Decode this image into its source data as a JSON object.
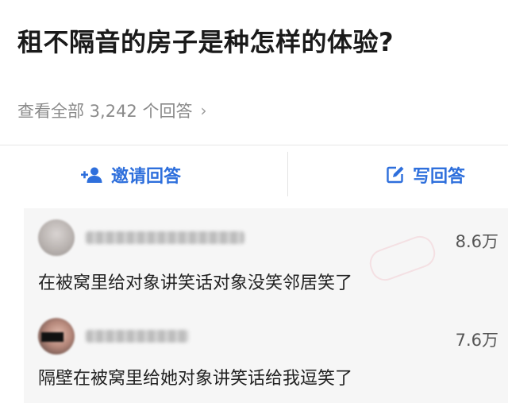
{
  "question": {
    "title": "租不隔音的房子是种怎样的体验?"
  },
  "answers_summary": {
    "text": "查看全部 3,242 个回答",
    "chevron": "›"
  },
  "actions": {
    "invite_label": "邀请回答",
    "invite_icon": "add-user-icon",
    "write_label": "写回答",
    "write_icon": "edit-icon",
    "accent_color": "#2e6fdc"
  },
  "answers": [
    {
      "votes": "8.6万",
      "text": "在被窝里给对象讲笑话对象没笑邻居笑了"
    },
    {
      "votes": "7.6万",
      "text": "隔壁在被窝里给她对象讲笑话给我逗笑了"
    }
  ]
}
